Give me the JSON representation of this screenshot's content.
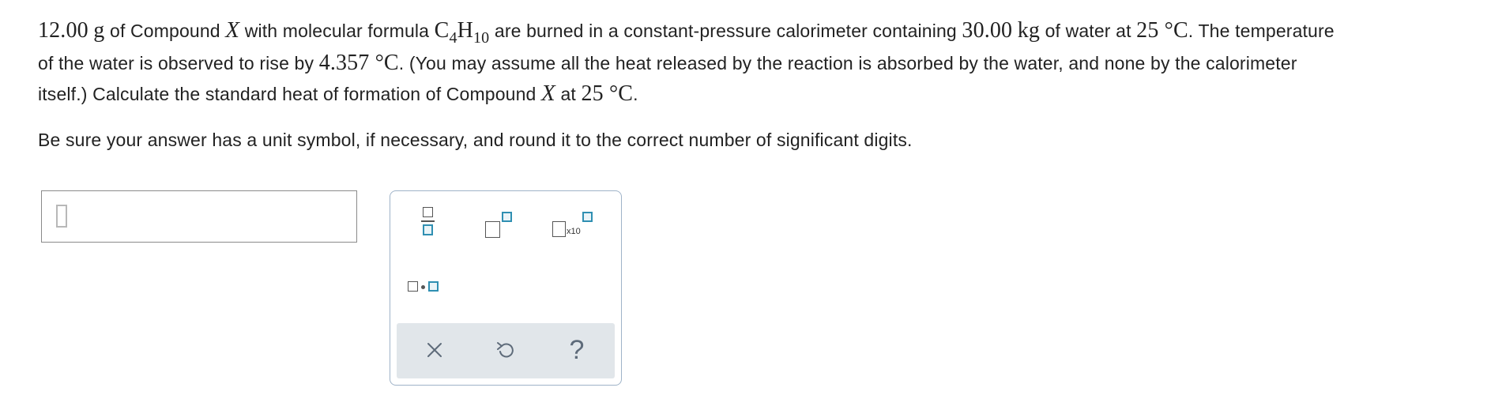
{
  "question": {
    "mass": "12.00",
    "mass_unit": "g",
    "t1": "of Compound",
    "compound_var": "X",
    "t2": "with molecular formula",
    "formula_c": "C",
    "formula_c_sub": "4",
    "formula_h": "H",
    "formula_h_sub": "10",
    "t3": "are burned in a constant-pressure calorimeter containing",
    "water_mass": "30.00",
    "water_unit": "kg",
    "t4": "of water at",
    "temp": "25 °C",
    "t5": ". The temperature",
    "t6": "of the water is observed to rise by",
    "rise": "4.357 °C",
    "t7": ". (You may assume all the heat released by the reaction is absorbed by the water, and none by the calorimeter",
    "t8": "itself.) Calculate the standard heat of formation of Compound",
    "t9": "at",
    "temp2": "25 °C",
    "t10": "."
  },
  "instruction": "Be sure your answer has a unit symbol, if necessary, and round it to the correct number of significant digits.",
  "answer": {
    "value": ""
  },
  "palette": {
    "x10_label": "x10",
    "tools": [
      "fraction-icon",
      "superscript-icon",
      "scientific-notation-icon",
      "multiply-dot-icon"
    ],
    "footer": [
      "clear-icon",
      "undo-icon",
      "help-icon"
    ],
    "help_label": "?"
  },
  "colors": {
    "accent": "#2f8fb2",
    "palette_border": "#9fb3c8",
    "footer_bg": "#e1e6ea"
  }
}
